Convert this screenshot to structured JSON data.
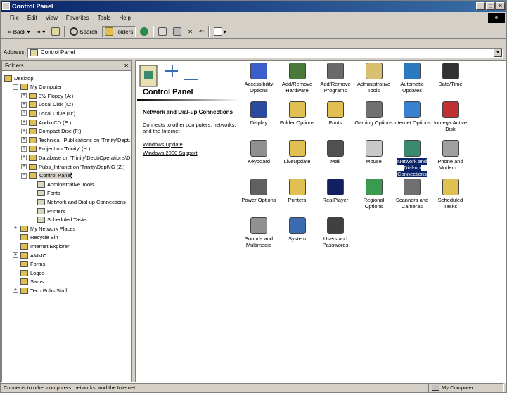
{
  "window": {
    "title": "Control Panel",
    "buttons": [
      "_",
      "□",
      "✕"
    ],
    "throbber": "e"
  },
  "menu": [
    "File",
    "Edit",
    "View",
    "Favorites",
    "Tools",
    "Help"
  ],
  "toolbar": {
    "back": "Back",
    "search": "Search",
    "folders": "Folders"
  },
  "address": {
    "label": "Address",
    "value": "Control Panel"
  },
  "folders_pane": {
    "title": "Folders",
    "close": "✕",
    "items": [
      {
        "label": "Desktop",
        "level": 0,
        "exp": ""
      },
      {
        "label": "My Computer",
        "level": 1,
        "exp": "-"
      },
      {
        "label": "3½ Floppy (A:)",
        "level": 2,
        "exp": "+"
      },
      {
        "label": "Local Disk (C:)",
        "level": 2,
        "exp": "+"
      },
      {
        "label": "Local Drive (D:)",
        "level": 2,
        "exp": "+"
      },
      {
        "label": "Audio CD (E:)",
        "level": 2,
        "exp": "+"
      },
      {
        "label": "Compact Disc (F:)",
        "level": 2,
        "exp": "+"
      },
      {
        "label": "Technical_Publications on 'Trinity\\Dept\\",
        "level": 2,
        "exp": "+"
      },
      {
        "label": "Project on 'Trinity' (H:)",
        "level": 2,
        "exp": "+"
      },
      {
        "label": "Database on 'Trinity\\Dept\\Operations\\D",
        "level": 2,
        "exp": "+"
      },
      {
        "label": "Pubs_Intranet on 'Trinity\\Dept\\IG (Z:)",
        "level": 2,
        "exp": "+"
      },
      {
        "label": "Control Panel",
        "level": 2,
        "exp": "-",
        "selected": true
      },
      {
        "label": "Administrative Tools",
        "level": 3,
        "exp": ""
      },
      {
        "label": "Fonts",
        "level": 3,
        "exp": ""
      },
      {
        "label": "Network and Dial-up Connections",
        "level": 3,
        "exp": ""
      },
      {
        "label": "Printers",
        "level": 3,
        "exp": ""
      },
      {
        "label": "Scheduled Tasks",
        "level": 3,
        "exp": ""
      },
      {
        "label": "My Network Places",
        "level": 1,
        "exp": "+"
      },
      {
        "label": "Recycle Bin",
        "level": 1,
        "exp": ""
      },
      {
        "label": "Internet Explorer",
        "level": 1,
        "exp": ""
      },
      {
        "label": "AMMO",
        "level": 1,
        "exp": "+"
      },
      {
        "label": "Forms",
        "level": 1,
        "exp": ""
      },
      {
        "label": "Logos",
        "level": 1,
        "exp": ""
      },
      {
        "label": "Sams",
        "level": 1,
        "exp": ""
      },
      {
        "label": "Tech Pubs Stuff",
        "level": 1,
        "exp": "+"
      }
    ]
  },
  "info": {
    "title": "Control Panel",
    "heading": "Network and Dial-up Connections",
    "desc": "Connects to other computers, networks, and the Internet",
    "links": [
      "Windows Update",
      "Windows 2000 Support"
    ]
  },
  "icons": [
    {
      "label": "Accessibility Options",
      "color": "#3a5fcd"
    },
    {
      "label": "Add/Remove Hardware",
      "color": "#4a7a3a"
    },
    {
      "label": "Add/Remove Programs",
      "color": "#6a6a6a"
    },
    {
      "label": "Administrative Tools",
      "color": "#d8c070"
    },
    {
      "label": "Automatic Updates",
      "color": "#2a7ac0"
    },
    {
      "label": "Date/Time",
      "color": "#333333"
    },
    {
      "label": "Display",
      "color": "#2a4aa0"
    },
    {
      "label": "Folder Options",
      "color": "#e0c050"
    },
    {
      "label": "Fonts",
      "color": "#e0c050"
    },
    {
      "label": "Gaming Options",
      "color": "#707070"
    },
    {
      "label": "Internet Options",
      "color": "#3a80d0"
    },
    {
      "label": "Iomega Active Disk",
      "color": "#c03030"
    },
    {
      "label": "Keyboard",
      "color": "#909090"
    },
    {
      "label": "LiveUpdate",
      "color": "#e0c050"
    },
    {
      "label": "Mail",
      "color": "#505050"
    },
    {
      "label": "Mouse",
      "color": "#c8c8c8"
    },
    {
      "label": "Network and Dial-up Connections",
      "color": "#3a8a70",
      "selected": true
    },
    {
      "label": "Phone and Modem ...",
      "color": "#a0a0a0"
    },
    {
      "label": "Power Options",
      "color": "#606060"
    },
    {
      "label": "Printers",
      "color": "#e0c050"
    },
    {
      "label": "RealPlayer",
      "color": "#102060"
    },
    {
      "label": "Regional Options",
      "color": "#3a9a50"
    },
    {
      "label": "Scanners and Cameras",
      "color": "#707070"
    },
    {
      "label": "Scheduled Tasks",
      "color": "#e0c050"
    },
    {
      "label": "Sounds and Multimedia",
      "color": "#909090"
    },
    {
      "label": "System",
      "color": "#3a6ab0"
    },
    {
      "label": "Users and Passwords",
      "color": "#404040"
    }
  ],
  "status": {
    "left": "Connects to other computers, networks, and the Internet",
    "right": "My Computer"
  }
}
